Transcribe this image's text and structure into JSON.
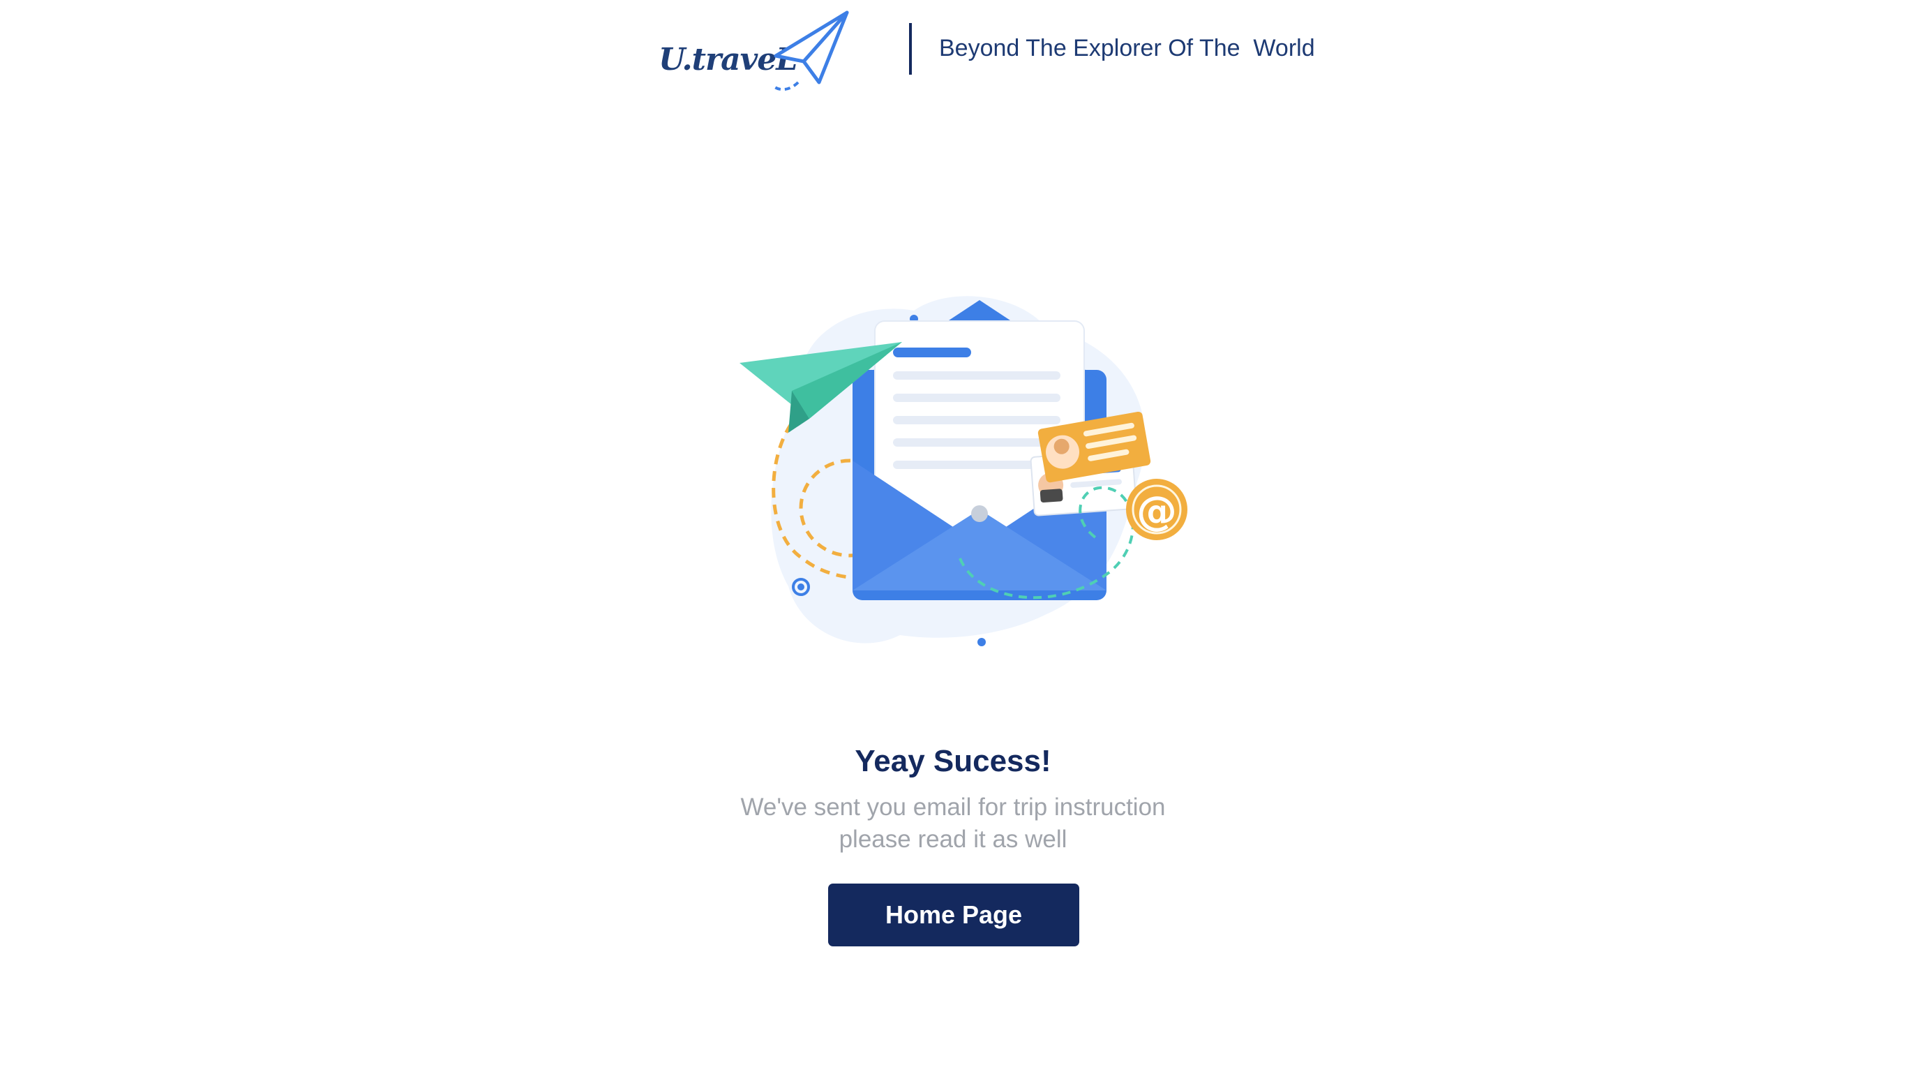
{
  "header": {
    "logo_text": "U.traveL",
    "tagline": "Beyond The Explorer Of The  World"
  },
  "illustration": {
    "name": "email-sent-illustration",
    "at_symbol": "@"
  },
  "success": {
    "title": "Yeay Sucess!",
    "message": "We've sent you email for trip instruction please read it as well",
    "button_label": "Home Page"
  },
  "colors": {
    "navy": "#14295e",
    "blue": "#3d7fe6",
    "orange": "#f2ae3f",
    "teal": "#4fcfb4",
    "muted_text": "#a0a4ab"
  }
}
